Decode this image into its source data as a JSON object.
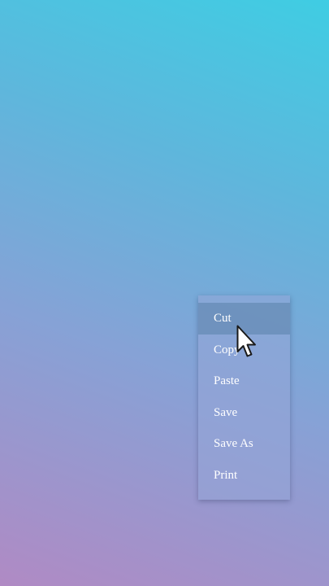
{
  "context_menu": {
    "items": [
      {
        "label": "Cut",
        "highlighted": true
      },
      {
        "label": "Copy",
        "highlighted": false
      },
      {
        "label": "Paste",
        "highlighted": false
      },
      {
        "label": "Save",
        "highlighted": false
      },
      {
        "label": "Save As",
        "highlighted": false
      },
      {
        "label": "Print",
        "highlighted": false
      }
    ]
  },
  "cursor": {
    "icon": "arrow-cursor-icon"
  },
  "colors": {
    "background_top": "#3fcde3",
    "background_bottom": "#b08ac4",
    "menu_text": "#ffffff"
  }
}
